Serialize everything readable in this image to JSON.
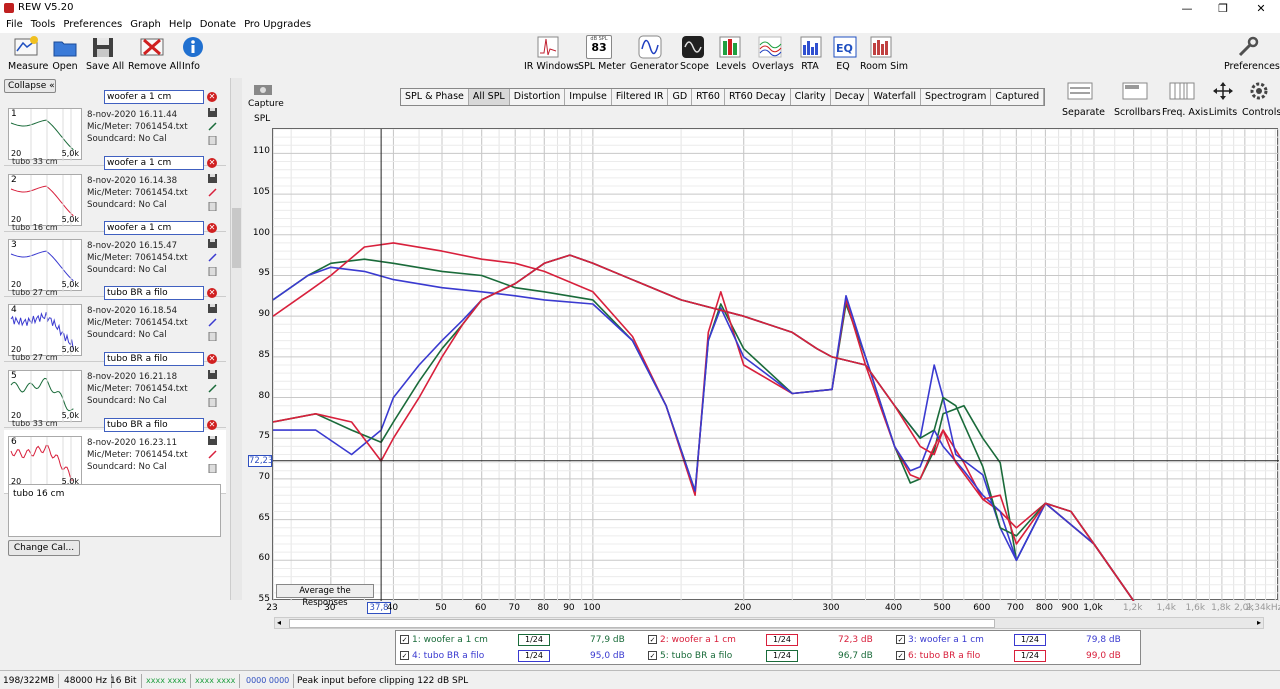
{
  "window": {
    "title": "REW V5.20",
    "min": "—",
    "max": "❐",
    "close": "✕"
  },
  "menu": [
    "File",
    "Tools",
    "Preferences",
    "Graph",
    "Help",
    "Donate",
    "Pro Upgrades"
  ],
  "toolbar_left": [
    {
      "label": "Measure"
    },
    {
      "label": "Open"
    },
    {
      "label": "Save All"
    },
    {
      "label": "Remove All"
    },
    {
      "label": "Info"
    }
  ],
  "toolbar_center": [
    {
      "label": "IR Windows"
    },
    {
      "label": "SPL Meter",
      "badge_top": "dB SPL",
      "badge": "83"
    },
    {
      "label": "Generator"
    },
    {
      "label": "Scope"
    },
    {
      "label": "Levels"
    },
    {
      "label": "Overlays"
    },
    {
      "label": "RTA"
    },
    {
      "label": "EQ"
    },
    {
      "label": "Room Sim"
    }
  ],
  "toolbar_right": {
    "preferences": "Preferences"
  },
  "graph_controls": [
    {
      "label": "Separate"
    },
    {
      "label": "Scrollbars"
    },
    {
      "label": "Freq. Axis"
    },
    {
      "label": "Limits"
    },
    {
      "label": "Controls"
    }
  ],
  "capture": "Capture",
  "collapse": "Collapse",
  "measurements": [
    {
      "num": "1",
      "name": "woofer a 1 cm",
      "date": "8-nov-2020 16.11.44",
      "mic": "Mic/Meter: 7061454.txt",
      "sc": "Soundcard: No Cal",
      "lo": "20",
      "hi": "5,0k",
      "cut": "tubo 33 cm",
      "color": "#1a6b3a"
    },
    {
      "num": "2",
      "name": "woofer a 1 cm",
      "date": "8-nov-2020 16.14.38",
      "mic": "Mic/Meter: 7061454.txt",
      "sc": "Soundcard: No Cal",
      "lo": "20",
      "hi": "5,0k",
      "cut": "tubo 16 cm",
      "color": "#d8203c"
    },
    {
      "num": "3",
      "name": "woofer a 1 cm",
      "date": "8-nov-2020 16.15.47",
      "mic": "Mic/Meter: 7061454.txt",
      "sc": "Soundcard: No Cal",
      "lo": "20",
      "hi": "5,0k",
      "cut": "tubo 27 cm",
      "color": "#3a3ad0"
    },
    {
      "num": "4",
      "name": "tubo BR a filo",
      "date": "8-nov-2020 16.18.54",
      "mic": "Mic/Meter: 7061454.txt",
      "sc": "Soundcard: No Cal",
      "lo": "20",
      "hi": "5,0k",
      "cut": "tubo 27 cm",
      "color": "#3a3ad0"
    },
    {
      "num": "5",
      "name": "tubo BR a filo",
      "date": "8-nov-2020 16.21.18",
      "mic": "Mic/Meter: 7061454.txt",
      "sc": "Soundcard: No Cal",
      "lo": "20",
      "hi": "5,0k",
      "cut": "tubo 33 cm",
      "color": "#1a6b3a"
    },
    {
      "num": "6",
      "name": "tubo BR a filo",
      "date": "8-nov-2020 16.23.11",
      "mic": "Mic/Meter: 7061454.txt",
      "sc": "Soundcard: No Cal",
      "lo": "20",
      "hi": "5,0k",
      "cut": "",
      "color": "#d8203c"
    }
  ],
  "notes": "tubo 16 cm",
  "change_cal": "Change Cal...",
  "tabs": [
    "SPL & Phase",
    "All SPL",
    "Distortion",
    "Impulse",
    "Filtered IR",
    "GD",
    "RT60",
    "RT60 Decay",
    "Clarity",
    "Decay",
    "Waterfall",
    "Spectrogram",
    "Captured"
  ],
  "active_tab": "All SPL",
  "avg_button": "Average the Responses",
  "cursor": {
    "y_readout": "72,23",
    "x_readout": "37,8"
  },
  "chart_data": {
    "type": "line",
    "ylabel": "SPL",
    "yticks": [
      "110",
      "105",
      "100",
      "95",
      "90",
      "85",
      "80",
      "75",
      "70",
      "65",
      "60",
      "55"
    ],
    "xticks": [
      "23",
      "30",
      "40",
      "50",
      "60",
      "70",
      "80",
      "90",
      "100",
      "200",
      "300",
      "400",
      "500",
      "600",
      "700",
      "800",
      "900",
      "1,0k",
      "1,2k",
      "1,4k",
      "1,6k",
      "1,8k",
      "2,0k",
      "2,34kHz"
    ],
    "xscale": "log",
    "xlim": [
      23,
      2340
    ],
    "ylim": [
      55,
      113
    ],
    "cursor_x": 37.8,
    "cursor_y": 72.23,
    "series": [
      {
        "name": "woofer a 1 cm",
        "color": "#1a6b3a",
        "x": [
          23,
          27,
          30,
          35,
          40,
          50,
          60,
          70,
          80,
          100,
          120,
          140,
          160,
          170,
          180,
          200,
          250,
          300,
          320,
          350,
          400,
          430,
          450,
          480,
          500,
          550,
          600,
          650,
          700,
          800,
          1000,
          1200
        ],
        "y": [
          92,
          95,
          96.5,
          97,
          96.5,
          95.5,
          95,
          93.5,
          93,
          92,
          87,
          79,
          68.5,
          87,
          91.5,
          86,
          80.5,
          81,
          91.5,
          85,
          74,
          69.5,
          70,
          73.5,
          78,
          79,
          75,
          72,
          60,
          67,
          62,
          55
        ]
      },
      {
        "name": "woofer a 1 cm",
        "color": "#d8203c",
        "x": [
          23,
          27,
          30,
          35,
          40,
          50,
          60,
          70,
          80,
          100,
          120,
          140,
          160,
          170,
          180,
          200,
          250,
          300,
          320,
          350,
          400,
          430,
          450,
          480,
          500,
          550,
          600,
          650,
          700,
          800,
          1000,
          1200
        ],
        "y": [
          90,
          93,
          95,
          98.5,
          99,
          98,
          97,
          96.5,
          95.5,
          93,
          87.5,
          79,
          68,
          88,
          93,
          84,
          80.5,
          81,
          92,
          84,
          74,
          70.5,
          70,
          74,
          76,
          72,
          67.5,
          66,
          64,
          67,
          62,
          55
        ]
      },
      {
        "name": "woofer a 1 cm",
        "color": "#3a3ad0",
        "x": [
          23,
          27,
          30,
          35,
          40,
          50,
          60,
          70,
          80,
          100,
          120,
          140,
          160,
          170,
          180,
          200,
          250,
          300,
          320,
          350,
          400,
          430,
          450,
          480,
          500,
          550,
          600,
          650,
          700,
          800,
          1000,
          1200
        ],
        "y": [
          92,
          95,
          96,
          95.5,
          94.5,
          93.5,
          93,
          92.5,
          92,
          91.5,
          87,
          79,
          68.5,
          87,
          91,
          85,
          80.5,
          81,
          92.5,
          85,
          74,
          71,
          71.5,
          76,
          74,
          71,
          68,
          66,
          60,
          67,
          62,
          55
        ]
      },
      {
        "name": "tubo BR a filo",
        "color": "#3a3ad0",
        "x": [
          23,
          28,
          33,
          37.8,
          40,
          45,
          50,
          55,
          60,
          70,
          80,
          90,
          100,
          150,
          200,
          250,
          280,
          300,
          350,
          400,
          450,
          480,
          500,
          530,
          600,
          650,
          700,
          800,
          900,
          1000,
          1200
        ],
        "y": [
          76,
          76,
          73,
          76,
          80,
          84,
          87,
          89.5,
          92,
          94,
          96.5,
          97.5,
          96.5,
          92,
          90,
          88,
          86,
          85,
          84,
          79,
          75,
          84,
          80,
          73,
          70.5,
          64,
          60,
          67,
          66,
          62,
          55
        ]
      },
      {
        "name": "tubo BR a filo",
        "color": "#1a6b3a",
        "x": [
          23,
          28,
          33,
          37.8,
          40,
          45,
          50,
          55,
          60,
          70,
          80,
          90,
          100,
          150,
          200,
          250,
          280,
          300,
          350,
          400,
          450,
          480,
          500,
          530,
          600,
          650,
          700,
          800,
          900,
          1000,
          1200
        ],
        "y": [
          77,
          78,
          76,
          74.5,
          77,
          82,
          86,
          89,
          92,
          94,
          96.5,
          97.5,
          96.5,
          92,
          90,
          88,
          86,
          85,
          84,
          79,
          75,
          76,
          80,
          79,
          71.5,
          64,
          63,
          67,
          66,
          62,
          55
        ]
      },
      {
        "name": "tubo BR a filo",
        "color": "#d8203c",
        "x": [
          23,
          28,
          33,
          37.8,
          40,
          45,
          50,
          55,
          60,
          70,
          80,
          90,
          100,
          150,
          200,
          250,
          280,
          300,
          350,
          400,
          450,
          480,
          500,
          530,
          600,
          650,
          700,
          800,
          900,
          1000,
          1200
        ],
        "y": [
          77,
          78,
          77,
          72.2,
          75,
          80,
          85,
          89,
          92,
          94,
          96.5,
          97.5,
          96.5,
          92,
          90,
          88,
          86,
          85,
          84,
          79,
          74,
          73,
          76,
          72,
          67.5,
          68,
          62,
          67,
          66,
          62,
          55
        ]
      }
    ]
  },
  "legend": [
    {
      "label": "1: woofer a 1 cm",
      "smooth": "1/24",
      "value": "77,9 dB",
      "color": "#1a6b3a"
    },
    {
      "label": "2: woofer a 1 cm",
      "smooth": "1/24",
      "value": "72,3 dB",
      "color": "#d8203c"
    },
    {
      "label": "3: woofer a 1 cm",
      "smooth": "1/24",
      "value": "79,8 dB",
      "color": "#3a3ad0"
    },
    {
      "label": "4: tubo BR a filo",
      "smooth": "1/24",
      "value": "95,0 dB",
      "color": "#3a3ad0"
    },
    {
      "label": "5: tubo BR a filo",
      "smooth": "1/24",
      "value": "96,7 dB",
      "color": "#1a6b3a"
    },
    {
      "label": "6: tubo BR a filo",
      "smooth": "1/24",
      "value": "99,0 dB",
      "color": "#d8203c"
    }
  ],
  "status": {
    "memory": "198/322MB",
    "rate": "48000 Hz",
    "bits": "16 Bit",
    "meters1": "xxxx xxxx",
    "meters2": "xxxx xxxx",
    "meters3": "xxxx xxxx",
    "meters4": "0000 0000",
    "peak": "Peak input before clipping 122 dB SPL"
  }
}
